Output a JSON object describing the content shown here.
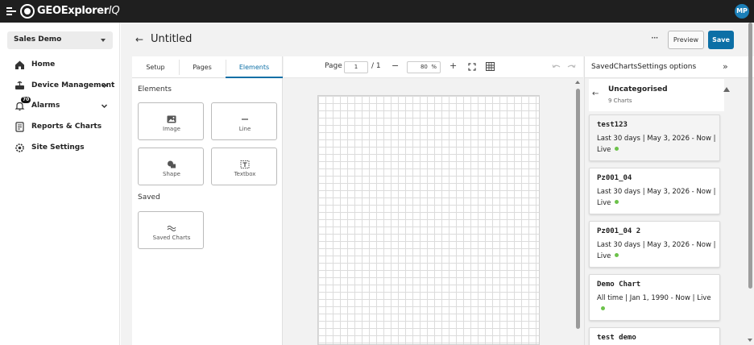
{
  "app": {
    "brand": "GEOExplorer",
    "brand_suffix": "IQ",
    "user_initials": "MP"
  },
  "sidebar": {
    "site": "Sales Demo",
    "items": [
      {
        "label": "Home",
        "icon": "home-icon"
      },
      {
        "label": "Device Management",
        "icon": "device-icon"
      },
      {
        "label": "Alarms",
        "icon": "bell-icon",
        "badge": "70"
      },
      {
        "label": "Reports & Charts",
        "icon": "report-icon"
      },
      {
        "label": "Site Settings",
        "icon": "gear-icon"
      }
    ]
  },
  "header": {
    "title": "Untitled",
    "more": "···",
    "preview_label": "Preview",
    "save_label": "Save"
  },
  "left_panel": {
    "tabs": [
      {
        "label": "Setup"
      },
      {
        "label": "Pages"
      },
      {
        "label": "Elements",
        "active": true
      }
    ],
    "elements_heading": "Elements",
    "elements": [
      {
        "label": "Image",
        "icon": "image-icon"
      },
      {
        "label": "Line",
        "icon": "line-icon"
      },
      {
        "label": "Shape",
        "icon": "shape-icon"
      },
      {
        "label": "Textbox",
        "icon": "textbox-icon"
      }
    ],
    "saved_heading": "Saved",
    "saved": [
      {
        "label": "Saved Charts",
        "icon": "chart-wave-icon"
      }
    ]
  },
  "canvas_toolbar": {
    "page_label": "Page",
    "page_value": "1",
    "page_total": "/ 1",
    "zoom_value": "80",
    "zoom_unit": "%"
  },
  "right_panel": {
    "title": "SavedChartsSettings options",
    "category": {
      "name": "Uncategorised",
      "count": "9 Charts"
    },
    "charts": [
      {
        "name": "test123",
        "desc": "Last 30 days | May 3, 2026 - Now | Live"
      },
      {
        "name": "Pz001_04",
        "desc": "Last 30 days | May 3, 2026 - Now | Live"
      },
      {
        "name": "Pz001_04 2",
        "desc": "Last 30 days | May 3, 2026 - Now | Live"
      },
      {
        "name": "Demo Chart",
        "desc": "All time | Jan 1, 1990 - Now | Live"
      },
      {
        "name": "test demo",
        "desc": ""
      }
    ]
  },
  "colors": {
    "accent": "#0c6fa6",
    "live": "#6cc24a",
    "topbar": "#1f1f1f"
  }
}
